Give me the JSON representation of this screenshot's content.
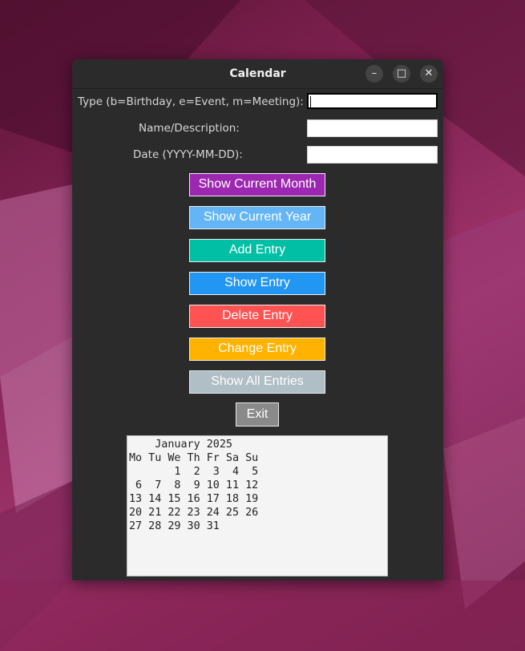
{
  "window": {
    "title": "Calendar",
    "controls": {
      "minimize": "–",
      "maximize": "□",
      "close": "✕"
    }
  },
  "form": {
    "type_label": "Type (b=Birthday, e=Event, m=Meeting):",
    "type_value": "",
    "name_label": "Name/Description:",
    "name_value": "",
    "date_label": "Date (YYYY-MM-DD):",
    "date_value": ""
  },
  "buttons": {
    "show_month": "Show Current Month",
    "show_year": "Show Current Year",
    "add": "Add Entry",
    "show": "Show Entry",
    "delete": "Delete Entry",
    "change": "Change Entry",
    "show_all": "Show All Entries",
    "exit": "Exit"
  },
  "colors": {
    "show_month": "#9c27b0",
    "show_year": "#64b5f6",
    "add": "#00bfa5",
    "show": "#2196f3",
    "delete": "#ff5252",
    "change": "#ffb300",
    "show_all": "#b0bec5",
    "exit": "#8a8a8a"
  },
  "calendar_text": "    January 2025\nMo Tu We Th Fr Sa Su\n       1  2  3  4  5\n 6  7  8  9 10 11 12\n13 14 15 16 17 18 19\n20 21 22 23 24 25 26\n27 28 29 30 31"
}
